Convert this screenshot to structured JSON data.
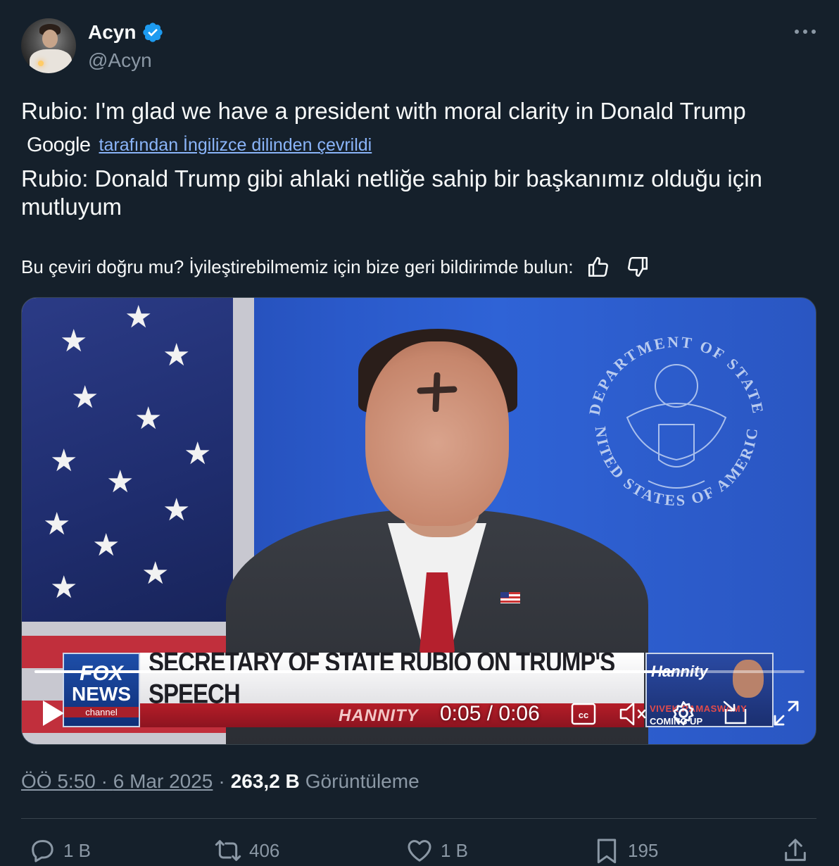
{
  "author": {
    "display_name": "Acyn",
    "handle": "@Acyn",
    "verified": true,
    "verified_color": "#1d9bf0"
  },
  "tweet": {
    "text": "Rubio: I'm glad we have a president with moral clarity in Donald Trump",
    "translation_provider": "Google",
    "translation_link": "tarafından İngilizce dilinden çevrildi",
    "translated_text": "Rubio: Donald Trump gibi ahlaki netliğe sahip bir başkanımız olduğu için mutluyum",
    "feedback_prompt": "Bu çeviri doğru mu? İyileştirebilmemiz için bize geri bildirimde bulun:"
  },
  "video": {
    "chyron_headline": "SECRETARY OF STATE RUBIO ON TRUMP'S SPEECH",
    "chyron_show": "HANNITY",
    "network_logo_line1": "FOX",
    "network_logo_line2": "NEWS",
    "network_logo_line3": "channel",
    "promo_show": "Hannity",
    "promo_name": "VIVEK RAMASWAMY",
    "promo_coming": "COMING UP",
    "seal_text_top": "DEPARTMENT OF STATE",
    "seal_text_bottom": "UNITED STATES OF AMERICA",
    "time_display": "0:05 / 0:06",
    "progress": 0.83,
    "muted": true
  },
  "meta": {
    "time": "ÖÖ 5:50",
    "date": "6 Mar 2025",
    "views_count": "263,2 B",
    "views_label": "Görüntüleme"
  },
  "actions": {
    "replies": "1 B",
    "retweets": "406",
    "likes": "1 B",
    "bookmarks": "195"
  },
  "colors": {
    "background": "#15202b",
    "text_primary": "#f7f9f9",
    "text_secondary": "#8b98a5",
    "link": "#8ab4f8"
  },
  "icons": [
    "more-icon",
    "verified-badge-icon",
    "thumbs-up-icon",
    "thumbs-down-icon",
    "play-icon",
    "captions-icon",
    "volume-muted-icon",
    "settings-icon",
    "picture-in-picture-icon",
    "fullscreen-icon",
    "reply-icon",
    "retweet-icon",
    "like-icon",
    "bookmark-icon",
    "share-icon"
  ]
}
